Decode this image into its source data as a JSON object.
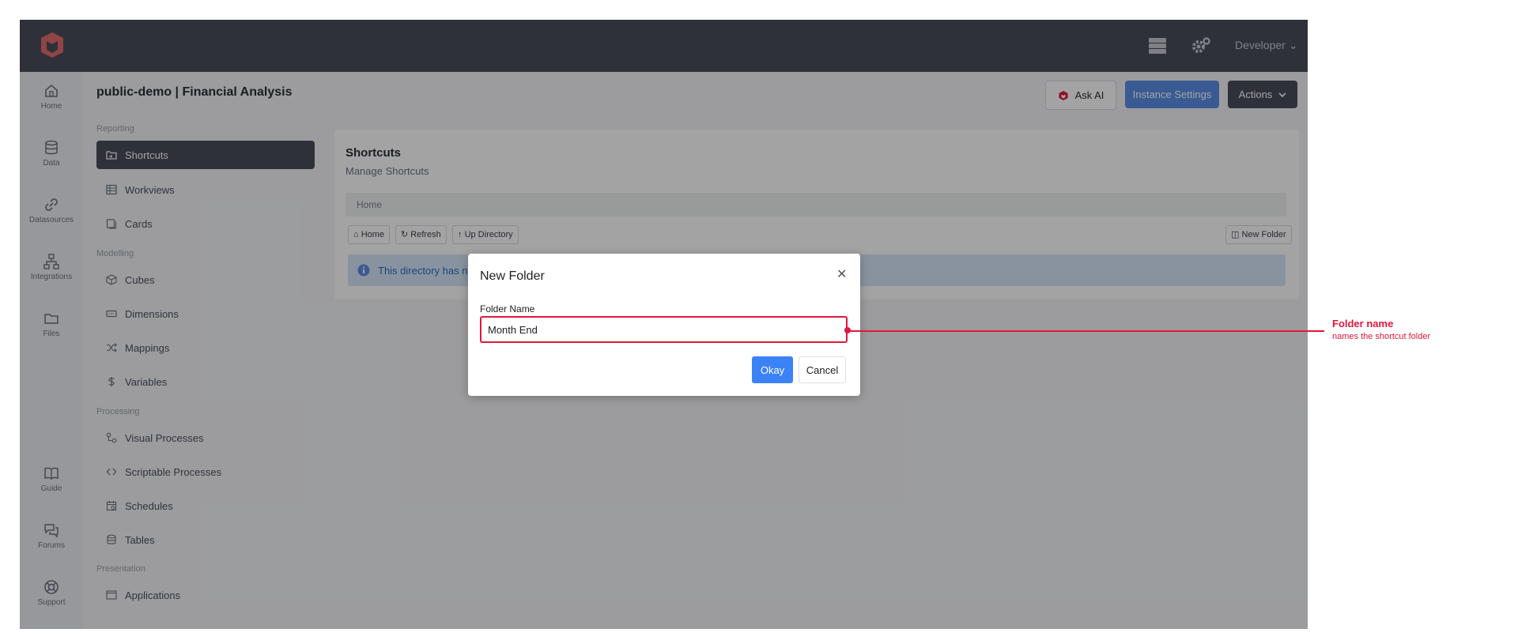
{
  "topbar": {
    "user_label": "Developer"
  },
  "leftnav": {
    "items": [
      {
        "label": "Home"
      },
      {
        "label": "Data"
      },
      {
        "label": "Datasources"
      },
      {
        "label": "Integrations"
      },
      {
        "label": "Files"
      },
      {
        "label": "Guide"
      },
      {
        "label": "Forums"
      },
      {
        "label": "Support"
      }
    ]
  },
  "header": {
    "title": "public-demo | Financial Analysis",
    "ask_ai_label": "Ask AI",
    "instance_settings_label": "Instance Settings",
    "actions_label": "Actions"
  },
  "sidebar": {
    "sections": {
      "reporting": "Reporting",
      "modelling": "Modelling",
      "processing": "Processing",
      "presentation": "Presentation"
    },
    "items": [
      {
        "label": "Shortcuts",
        "icon": "shortcut-folder-icon",
        "active": true
      },
      {
        "label": "Workviews",
        "icon": "table-icon"
      },
      {
        "label": "Cards",
        "icon": "cards-icon"
      },
      {
        "label": "Cubes",
        "icon": "cube-icon"
      },
      {
        "label": "Dimensions",
        "icon": "dimensions-icon"
      },
      {
        "label": "Mappings",
        "icon": "shuffle-icon"
      },
      {
        "label": "Variables",
        "icon": "dollar-icon"
      },
      {
        "label": "Visual Processes",
        "icon": "process-icon"
      },
      {
        "label": "Scriptable Processes",
        "icon": "code-icon"
      },
      {
        "label": "Schedules",
        "icon": "calendar-icon"
      },
      {
        "label": "Tables",
        "icon": "database-icon"
      },
      {
        "label": "Applications",
        "icon": "window-icon"
      }
    ]
  },
  "main": {
    "title": "Shortcuts",
    "subtitle": "Manage Shortcuts",
    "breadcrumb": "Home",
    "toolbar": {
      "home_label": "Home",
      "refresh_label": "Refresh",
      "up_label": "Up Directory",
      "new_folder_label": "New Folder"
    },
    "info_text": "This directory has n"
  },
  "modal": {
    "title": "New Folder",
    "field_label": "Folder Name",
    "field_value": "Month End",
    "okay_label": "Okay",
    "cancel_label": "Cancel"
  },
  "annotation": {
    "title": "Folder name",
    "subtitle": "names the shortcut folder",
    "color": "#e0173d"
  },
  "colors": {
    "topbar": "#4a4e5c",
    "primary": "#3b82f6",
    "accent_red": "#e0173d"
  }
}
